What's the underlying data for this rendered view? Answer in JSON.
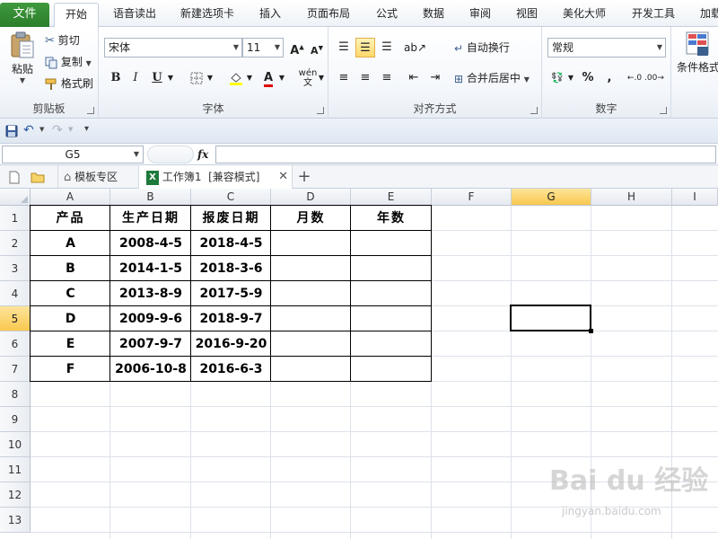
{
  "tabs": {
    "file": "文件",
    "items": [
      "开始",
      "语音读出",
      "新建选项卡",
      "插入",
      "页面布局",
      "公式",
      "数据",
      "审阅",
      "视图",
      "美化大师",
      "开发工具",
      "加载"
    ],
    "active": "开始"
  },
  "ribbon": {
    "clipboard": {
      "paste": "粘贴",
      "cut": "剪切",
      "copy": "复制",
      "format_painter": "格式刷",
      "label": "剪贴板"
    },
    "font": {
      "name": "宋体",
      "size": "11",
      "bold": "B",
      "italic": "I",
      "underline": "U",
      "label": "字体"
    },
    "alignment": {
      "wrap_text": "自动换行",
      "merge_center": "合并后居中",
      "label": "对齐方式"
    },
    "number": {
      "format": "常规",
      "percent": "%",
      "comma": ",",
      "label": "数字"
    },
    "styles": {
      "conditional": "条件格式"
    }
  },
  "formula_bar": {
    "name_box": "G5",
    "fx": "fx",
    "content": ""
  },
  "doc_tabs": {
    "template": "模板专区",
    "workbook": "工作簿1  [兼容模式]"
  },
  "sheet": {
    "columns": [
      "A",
      "B",
      "C",
      "D",
      "E",
      "F",
      "G",
      "H",
      "I"
    ],
    "rows": [
      "1",
      "2",
      "3",
      "4",
      "5",
      "6",
      "7",
      "8",
      "9",
      "10",
      "11",
      "12",
      "13"
    ],
    "selected_cell": "G5",
    "header": [
      "产品",
      "生产日期",
      "报废日期",
      "月数",
      "年数"
    ],
    "data": [
      [
        "A",
        "2008-4-5",
        "2018-4-5",
        "",
        ""
      ],
      [
        "B",
        "2014-1-5",
        "2018-3-6",
        "",
        ""
      ],
      [
        "C",
        "2013-8-9",
        "2017-5-9",
        "",
        ""
      ],
      [
        "D",
        "2009-9-6",
        "2018-9-7",
        "",
        ""
      ],
      [
        "E",
        "2007-9-7",
        "2016-9-20",
        "",
        ""
      ],
      [
        "F",
        "2006-10-8",
        "2016-6-3",
        "",
        ""
      ]
    ]
  },
  "watermark": {
    "brand": "Bai du 经验",
    "url": "jingyan.baidu.com"
  }
}
